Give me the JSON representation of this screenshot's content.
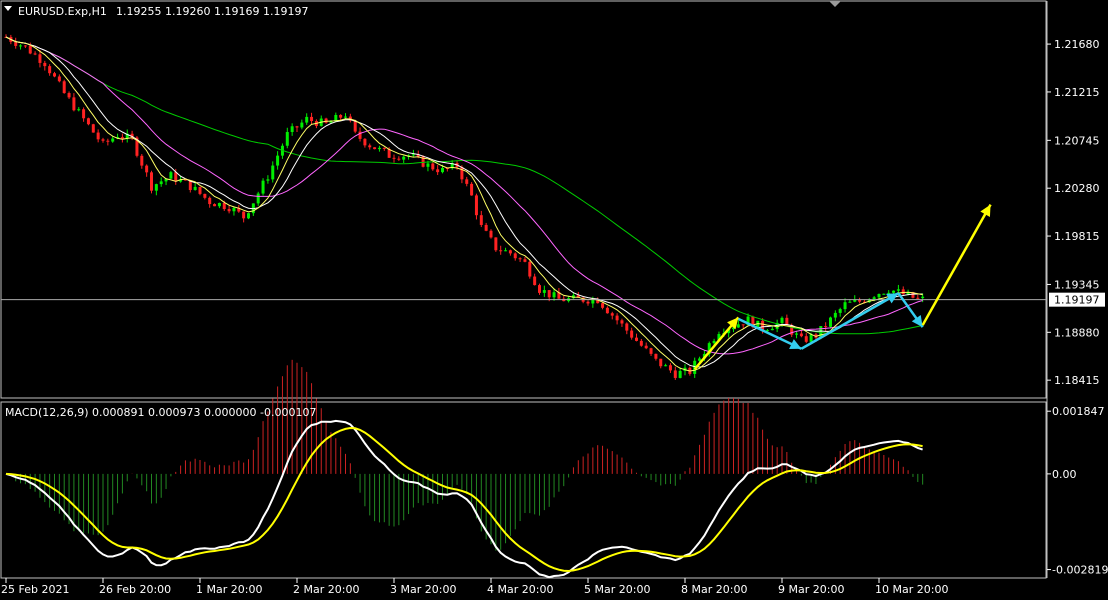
{
  "chart_data": {
    "type": "candlestick",
    "symbol_info": {
      "symbol": "EURUSD.Exp,H1",
      "values": "1.19255 1.19260 1.19169 1.19197"
    },
    "price_axis": {
      "ylim": [
        1.183,
        1.2205
      ],
      "ticks": [
        "1.21680",
        "1.21215",
        "1.20745",
        "1.20280",
        "1.19815",
        "1.19345",
        "1.18880",
        "1.18415"
      ],
      "tick_values": [
        1.2168,
        1.21215,
        1.20745,
        1.2028,
        1.19815,
        1.19345,
        1.1888,
        1.18415
      ],
      "current_price": "1.19197",
      "current_value": 1.19197
    },
    "time_axis": {
      "labels": [
        "25 Feb 2021",
        "26 Feb 20:00",
        "1 Mar 20:00",
        "2 Mar 20:00",
        "3 Mar 20:00",
        "4 Mar 20:00",
        "5 Mar 20:00",
        "8 Mar 20:00",
        "9 Mar 20:00",
        "10 Mar 20:00"
      ],
      "label_bars": [
        0,
        20,
        40,
        60,
        80,
        100,
        120,
        140,
        160,
        180
      ]
    },
    "price_path": [
      [
        0,
        1.2175
      ],
      [
        4,
        1.2165
      ],
      [
        8,
        1.215
      ],
      [
        12,
        1.212
      ],
      [
        16,
        1.2095
      ],
      [
        20,
        1.207
      ],
      [
        23,
        1.208
      ],
      [
        26,
        1.2075
      ],
      [
        30,
        1.203
      ],
      [
        34,
        1.204
      ],
      [
        38,
        1.203
      ],
      [
        42,
        1.2015
      ],
      [
        46,
        1.201
      ],
      [
        49,
        1.2
      ],
      [
        51,
        1.2015
      ],
      [
        54,
        1.204
      ],
      [
        58,
        1.208
      ],
      [
        62,
        1.2095
      ],
      [
        66,
        1.209
      ],
      [
        70,
        1.21
      ],
      [
        72,
        1.208
      ],
      [
        75,
        1.207
      ],
      [
        79,
        1.206
      ],
      [
        83,
        1.206
      ],
      [
        87,
        1.205
      ],
      [
        90,
        1.2045
      ],
      [
        93,
        1.205
      ],
      [
        96,
        1.202
      ],
      [
        98,
        1.199
      ],
      [
        101,
        1.197
      ],
      [
        104,
        1.1965
      ],
      [
        107,
        1.1955
      ],
      [
        110,
        1.193
      ],
      [
        114,
        1.192
      ],
      [
        118,
        1.192
      ],
      [
        122,
        1.192
      ],
      [
        126,
        1.19
      ],
      [
        130,
        1.188
      ],
      [
        134,
        1.186
      ],
      [
        138,
        1.1848
      ],
      [
        141,
        1.185
      ],
      [
        144,
        1.187
      ],
      [
        147,
        1.189
      ],
      [
        150,
        1.1895
      ],
      [
        153,
        1.19
      ],
      [
        156,
        1.1892
      ],
      [
        160,
        1.1898
      ],
      [
        164,
        1.188
      ],
      [
        167,
        1.1885
      ],
      [
        170,
        1.19
      ],
      [
        173,
        1.1915
      ],
      [
        176,
        1.1918
      ],
      [
        179,
        1.1925
      ],
      [
        182,
        1.193
      ],
      [
        185,
        1.1925
      ],
      [
        188,
        1.192
      ]
    ],
    "indicators": [
      {
        "name": "ma-slow",
        "color": "#00cc00",
        "period": 55
      },
      {
        "name": "ma-mid",
        "color": "#ff66ff",
        "period": 21
      },
      {
        "name": "ma-fast",
        "color": "#ffffff",
        "period": 10
      },
      {
        "name": "ma-faster",
        "color": "#ffff66",
        "period": 6
      }
    ],
    "arrows": [
      {
        "color": "#ffff00",
        "from": [
          142,
          1.1852
        ],
        "to": [
          151,
          1.19025
        ]
      },
      {
        "color": "#33ccee",
        "from": [
          151,
          1.1901
        ],
        "to": [
          164,
          1.1872
        ]
      },
      {
        "color": "#33ccee",
        "from": [
          164,
          1.1872
        ],
        "to": [
          184,
          1.1926
        ]
      },
      {
        "color": "#33ccee",
        "from": [
          184,
          1.1926
        ],
        "to": [
          189,
          1.1893
        ]
      },
      {
        "color": "#ffff00",
        "from": [
          189,
          1.1895
        ],
        "to": [
          203,
          1.2012
        ]
      }
    ],
    "macd": {
      "label": "MACD(12,26,9) 0.000891 0.000973 0.000000 -0.000107",
      "ylim": [
        -0.00295,
        0.002
      ],
      "ticks": [
        "0.001847",
        "0.00",
        "-0.002819"
      ],
      "tick_values": [
        0.001847,
        0,
        -0.002819
      ],
      "macd_color": "#ffffff",
      "signal_color": "#ffff00",
      "hist_up_color": "#cc2222",
      "hist_down_color": "#228822"
    },
    "colors": {
      "bull": "#00ee00",
      "bear": "#ff2222",
      "axis": "#ffffff",
      "current_line": "#aaaaaa"
    }
  }
}
